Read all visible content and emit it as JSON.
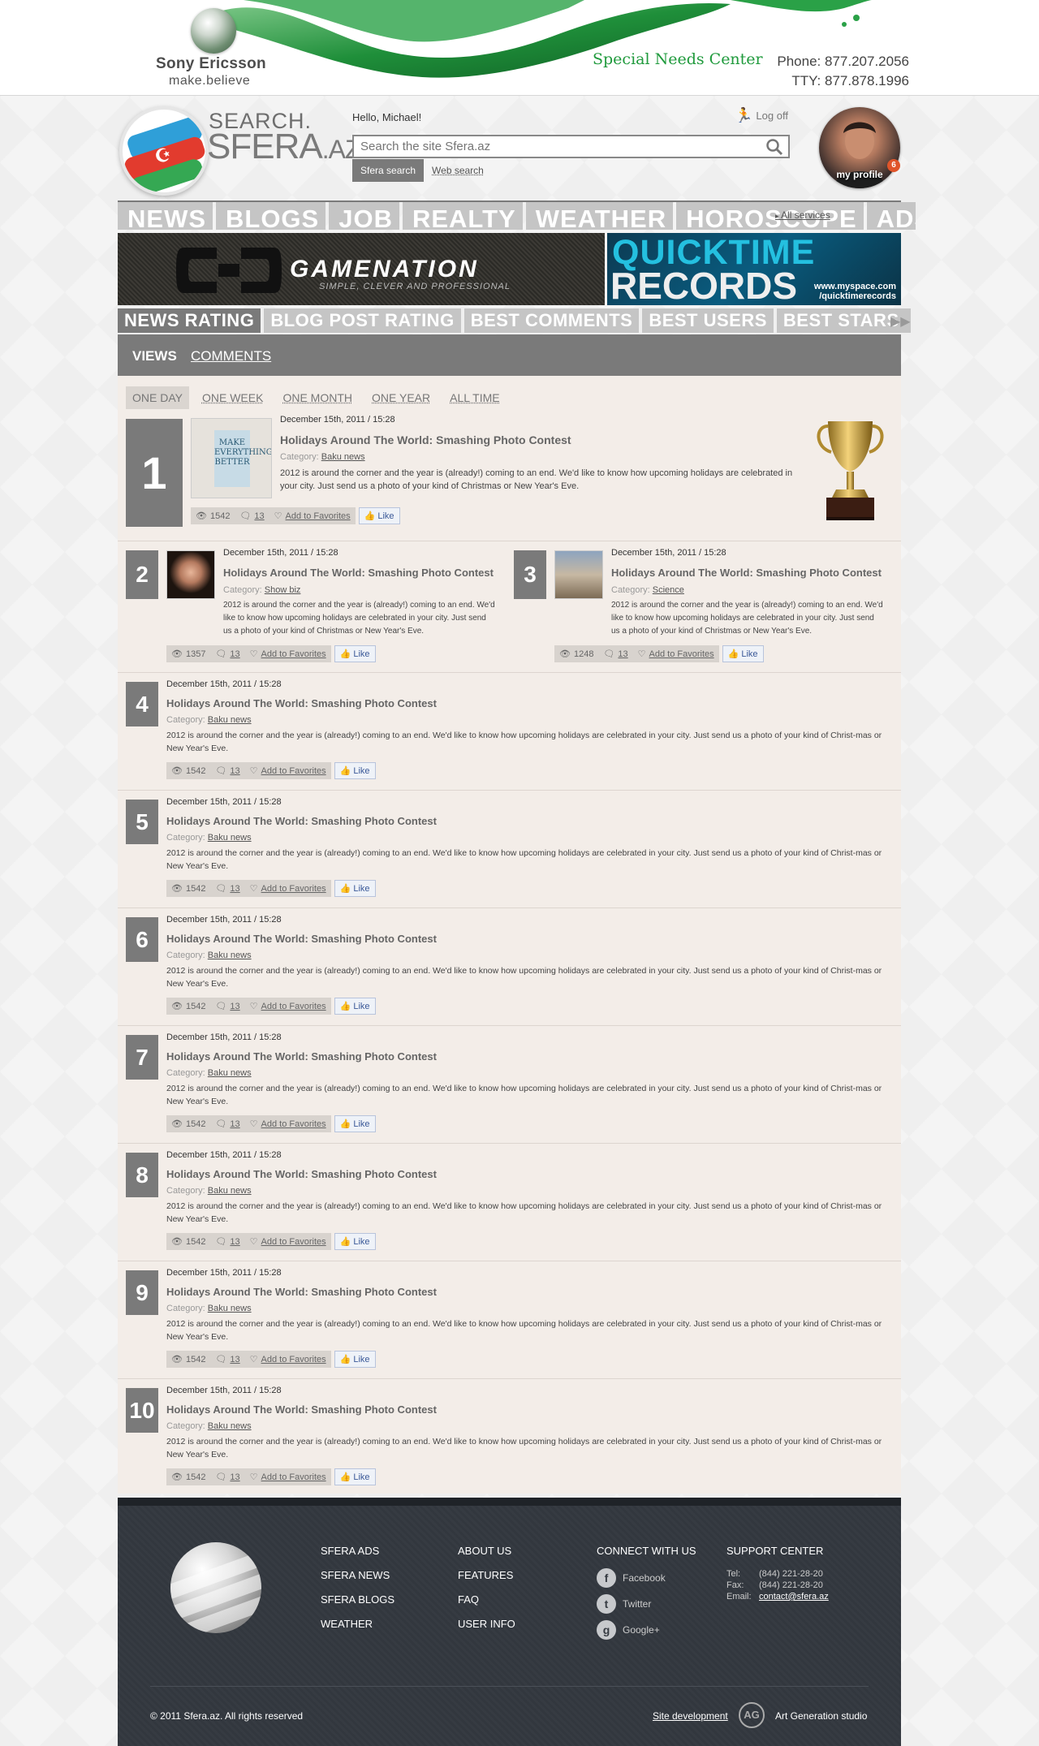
{
  "top_banner": {
    "brand_name": "Sony Ericsson",
    "brand_tagline": "make.believe",
    "special_needs": "Special Needs Center",
    "phone": "Phone: 877.207.2056",
    "tty": "TTY: 877.878.1996"
  },
  "header": {
    "logo_text_top": "SEARCH.",
    "logo_text_main": "SFERA",
    "logo_text_suffix": ".AZ",
    "greeting": "Hello, Michael!",
    "logout_label": "Log off",
    "search_placeholder": "Search the site Sfera.az",
    "search_tabs": [
      "Sfera search",
      "Web search"
    ],
    "profile_label": "my profile",
    "profile_badge": "6"
  },
  "main_nav": {
    "items": [
      "NEWS",
      "BLOGS",
      "JOB",
      "REALTY",
      "WEATHER",
      "HOROSCOPE",
      "ADS"
    ],
    "all_services": "All services"
  },
  "ads": {
    "gamenation_title": "GAMENATION",
    "gamenation_sub": "SIMPLE, CLEVER AND PROFESSIONAL",
    "quicktime_line1": "QUICKTIME",
    "quicktime_line2": "RECORDS",
    "quicktime_url1": "www.myspace.com",
    "quicktime_url2": "/quicktimerecords"
  },
  "rating_tabs": [
    "NEWS RATING",
    "BLOG POST RATING",
    "BEST COMMENTS",
    "BEST USERS",
    "BEST STARS"
  ],
  "view_tabs": [
    "VIEWS",
    "COMMENTS"
  ],
  "period_tabs": [
    "ONE DAY",
    "ONE WEEK",
    "ONE MONTH",
    "ONE YEAR",
    "ALL TIME"
  ],
  "labels": {
    "category": "Category:",
    "add_favorites": "Add to Favorites",
    "like": "Like"
  },
  "thumb1_text": [
    "MAKE",
    "EVERYTHING",
    "BETTER"
  ],
  "items": [
    {
      "rank": "1",
      "date": "December 15th, 2011 / 15:28",
      "title": "Holidays Around The World: Smashing Photo Contest",
      "category": "Baku news",
      "desc": "2012 is around the corner and the year is (already!) coming to an end. We'd like to know how upcoming holidays are celebrated in your city. Just send us a photo of your kind of Christmas or New Year's Eve.",
      "views": "1542",
      "comments": "13"
    },
    {
      "rank": "2",
      "date": "December 15th, 2011 / 15:28",
      "title": "Holidays Around The World: Smashing Photo Contest",
      "category": "Show biz",
      "desc": "2012 is around the corner and the year is (already!) coming to an end. We'd like to know how upcoming holidays are celebrated in your city. Just send us a photo of your kind of Christmas or New Year's Eve.",
      "views": "1357",
      "comments": "13"
    },
    {
      "rank": "3",
      "date": "December 15th, 2011 / 15:28",
      "title": "Holidays Around The World: Smashing Photo Contest",
      "category": "Science",
      "desc": "2012 is around the corner and the year is (already!) coming to an end. We'd like to know how upcoming holidays are celebrated in your city. Just send us a photo of your kind of Christmas or New Year's Eve.",
      "views": "1248",
      "comments": "13"
    },
    {
      "rank": "4",
      "date": "December 15th, 2011 / 15:28",
      "title": "Holidays Around The World: Smashing Photo Contest",
      "category": "Baku news",
      "desc": "2012 is around the corner and the year is (already!) coming to an end. We'd like to know how upcoming holidays are celebrated in your city. Just send us a photo of your kind of Christ-mas or New Year's Eve.",
      "views": "1542",
      "comments": "13"
    },
    {
      "rank": "5",
      "date": "December 15th, 2011 / 15:28",
      "title": "Holidays Around The World: Smashing Photo Contest",
      "category": "Baku news",
      "desc": "2012 is around the corner and the year is (already!) coming to an end. We'd like to know how upcoming holidays are celebrated in your city. Just send us a photo of your kind of Christ-mas or New Year's Eve.",
      "views": "1542",
      "comments": "13"
    },
    {
      "rank": "6",
      "date": "December 15th, 2011 / 15:28",
      "title": "Holidays Around The World: Smashing Photo Contest",
      "category": "Baku news",
      "desc": "2012 is around the corner and the year is (already!) coming to an end. We'd like to know how upcoming holidays are celebrated in your city. Just send us a photo of your kind of Christ-mas or New Year's Eve.",
      "views": "1542",
      "comments": "13"
    },
    {
      "rank": "7",
      "date": "December 15th, 2011 / 15:28",
      "title": "Holidays Around The World: Smashing Photo Contest",
      "category": "Baku news",
      "desc": "2012 is around the corner and the year is (already!) coming to an end. We'd like to know how upcoming holidays are celebrated in your city. Just send us a photo of your kind of Christ-mas or New Year's Eve.",
      "views": "1542",
      "comments": "13"
    },
    {
      "rank": "8",
      "date": "December 15th, 2011 / 15:28",
      "title": "Holidays Around The World: Smashing Photo Contest",
      "category": "Baku news",
      "desc": "2012 is around the corner and the year is (already!) coming to an end. We'd like to know how upcoming holidays are celebrated in your city. Just send us a photo of your kind of Christ-mas or New Year's Eve.",
      "views": "1542",
      "comments": "13"
    },
    {
      "rank": "9",
      "date": "December 15th, 2011 / 15:28",
      "title": "Holidays Around The World: Smashing Photo Contest",
      "category": "Baku news",
      "desc": "2012 is around the corner and the year is (already!) coming to an end. We'd like to know how upcoming holidays are celebrated in your city. Just send us a photo of your kind of Christ-mas or New Year's Eve.",
      "views": "1542",
      "comments": "13"
    },
    {
      "rank": "10",
      "date": "December 15th, 2011 / 15:28",
      "title": "Holidays Around The World: Smashing Photo Contest",
      "category": "Baku news",
      "desc": "2012 is around the corner and the year is (already!) coming to an end. We'd like to know how upcoming holidays are celebrated in your city. Just send us a photo of your kind of Christ-mas or New Year's Eve.",
      "views": "1542",
      "comments": "13"
    }
  ],
  "footer": {
    "col1": [
      "SFERA ADS",
      "SFERA NEWS",
      "SFERA BLOGS",
      "WEATHER"
    ],
    "col2": [
      "ABOUT US",
      "FEATURES",
      "FAQ",
      "USER INFO"
    ],
    "connect_title": "CONNECT WITH US",
    "social": [
      "Facebook",
      "Twitter",
      "Google+"
    ],
    "support_title": "SUPPORT CENTER",
    "tel_label": "Tel:",
    "tel": "(844) 221-28-20",
    "fax_label": "Fax:",
    "fax": "(844) 221-28-20",
    "email_label": "Email:",
    "email": "contact@sfera.az",
    "copyright": "© 2011 Sfera.az. All rights reserved",
    "site_dev": "Site development",
    "studio": "Art Generation studio"
  },
  "colors": {
    "accent_grey": "#7a7a7a",
    "content_bg": "#f3ede8",
    "footer_bg": "#363b42",
    "banner_green": "#1f9a3c",
    "like_blue": "#3b5998"
  }
}
